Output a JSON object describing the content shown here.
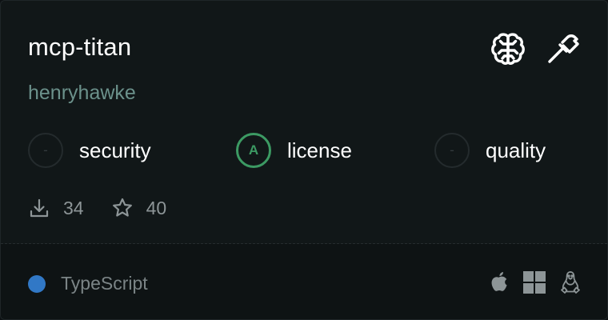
{
  "server": {
    "name": "mcp-titan",
    "author": "henryhawke",
    "capability_icons": [
      "brain-icon",
      "hammer-icon"
    ]
  },
  "scores": [
    {
      "label": "security",
      "grade": "-"
    },
    {
      "label": "license",
      "grade": "A"
    },
    {
      "label": "quality",
      "grade": "-"
    }
  ],
  "stats": {
    "downloads": "34",
    "stars": "40"
  },
  "footer": {
    "language": "TypeScript",
    "language_color": "#3178c6",
    "platforms": [
      "apple-icon",
      "windows-icon",
      "linux-icon"
    ]
  },
  "colors": {
    "grade_a": "#3c9a63",
    "author": "#6b918b",
    "background": "#111718"
  }
}
